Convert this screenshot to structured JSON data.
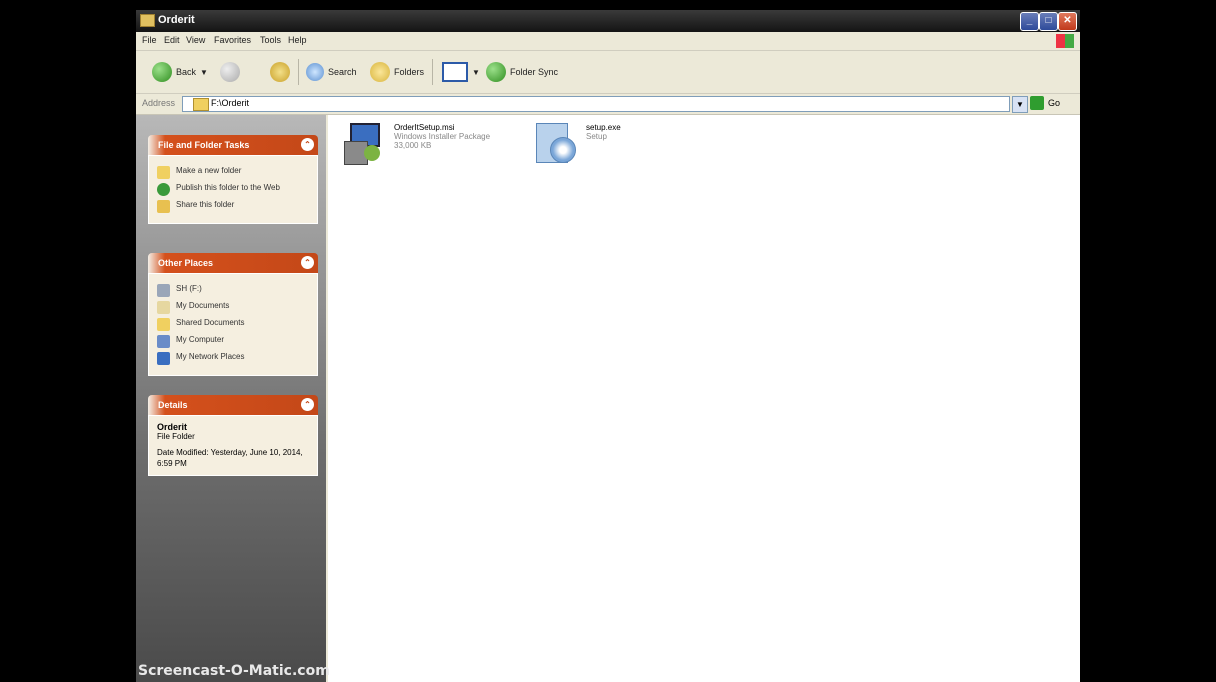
{
  "window": {
    "title": "Orderit"
  },
  "menu": [
    "File",
    "Edit",
    "View",
    "Favorites",
    "Tools",
    "Help"
  ],
  "toolbar": {
    "back": "Back",
    "search": "Search",
    "folders": "Folders",
    "folder_sync": "Folder Sync"
  },
  "address": {
    "label": "Address",
    "path": "F:\\Orderit",
    "go": "Go"
  },
  "panels": {
    "tasks": {
      "title": "File and Folder Tasks",
      "items": [
        "Make a new folder",
        "Publish this folder to the Web",
        "Share this folder"
      ]
    },
    "places": {
      "title": "Other Places",
      "items": [
        "SH (F:)",
        "My Documents",
        "Shared Documents",
        "My Computer",
        "My Network Places"
      ]
    },
    "details": {
      "title": "Details",
      "name": "Orderit",
      "type": "File Folder",
      "modified": "Date Modified: Yesterday, June 10, 2014, 6:59 PM"
    }
  },
  "files": [
    {
      "name": "OrderItSetup.msi",
      "type": "Windows Installer Package",
      "size": "33,000 KB"
    },
    {
      "name": "setup.exe",
      "type": "Setup"
    }
  ],
  "watermark": "Screencast-O-Matic.com"
}
